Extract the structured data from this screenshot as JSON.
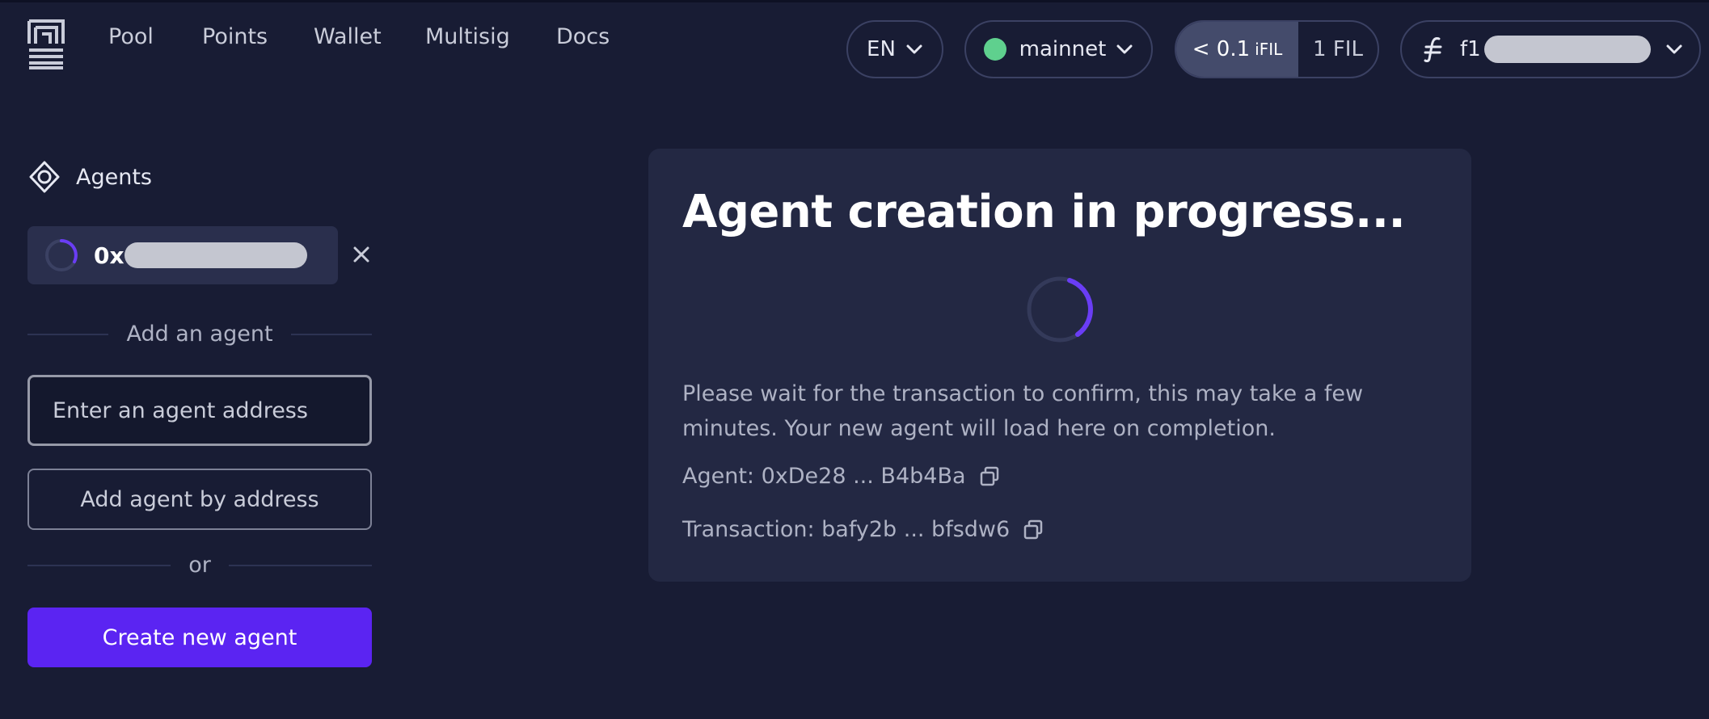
{
  "nav": {
    "links": [
      "Pool",
      "Points",
      "Wallet",
      "Multisig",
      "Docs"
    ]
  },
  "header": {
    "language": "EN",
    "network": "mainnet",
    "network_status_color": "#5fd08e",
    "toggle": {
      "option_a": "< 0.1",
      "option_a_unit": "iFIL",
      "option_b": "1 FIL"
    },
    "account_prefix": "f1",
    "icons": [
      "logo-icon",
      "chevron-down-icon",
      "filecoin-icon"
    ]
  },
  "sidebar": {
    "title": "Agents",
    "agent_address_prefix": "0x",
    "add_divider": "Add an agent",
    "input_placeholder": "Enter an agent address",
    "add_button": "Add agent by address",
    "or_divider": "or",
    "create_button": "Create new agent"
  },
  "card": {
    "title": "Agent creation in progress...",
    "description": "Please wait for the transaction to confirm, this may take a few minutes. Your new agent will load here on completion.",
    "agent_line": "Agent: 0xDe28 ... B4b4Ba",
    "transaction_line": "Transaction: bafy2b ... bfsdw6"
  },
  "colors": {
    "background": "#181c34",
    "card": "#232843",
    "accent": "#5b24f2"
  }
}
